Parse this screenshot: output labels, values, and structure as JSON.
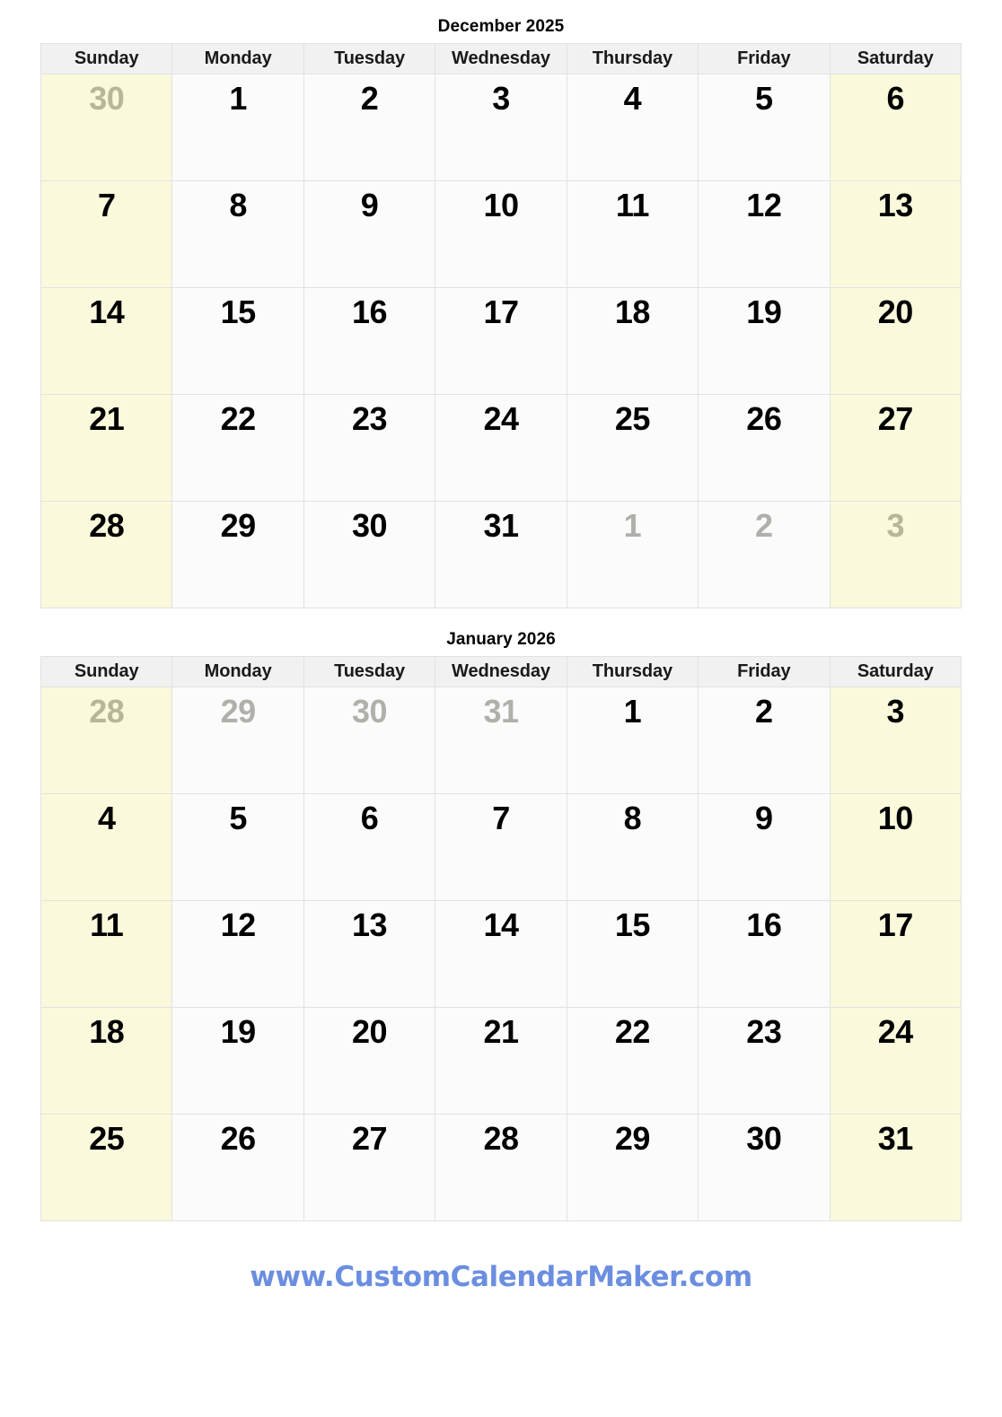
{
  "colors": {
    "weekend_background": "#faf9dc",
    "weekday_background": "#fbfbfb",
    "header_background": "#f1f1f1",
    "out_of_month_text": "#b0b0ab",
    "in_month_text": "#000000",
    "footer_link": "#6b8ee0",
    "grid_border": "#e2e2e2"
  },
  "weekday_headers": [
    "Sunday",
    "Monday",
    "Tuesday",
    "Wednesday",
    "Thursday",
    "Friday",
    "Saturday"
  ],
  "months": [
    {
      "title": "December 2025",
      "weeks": [
        [
          {
            "day": "30",
            "in_month": false
          },
          {
            "day": "1",
            "in_month": true
          },
          {
            "day": "2",
            "in_month": true
          },
          {
            "day": "3",
            "in_month": true
          },
          {
            "day": "4",
            "in_month": true
          },
          {
            "day": "5",
            "in_month": true
          },
          {
            "day": "6",
            "in_month": true
          }
        ],
        [
          {
            "day": "7",
            "in_month": true
          },
          {
            "day": "8",
            "in_month": true
          },
          {
            "day": "9",
            "in_month": true
          },
          {
            "day": "10",
            "in_month": true
          },
          {
            "day": "11",
            "in_month": true
          },
          {
            "day": "12",
            "in_month": true
          },
          {
            "day": "13",
            "in_month": true
          }
        ],
        [
          {
            "day": "14",
            "in_month": true
          },
          {
            "day": "15",
            "in_month": true
          },
          {
            "day": "16",
            "in_month": true
          },
          {
            "day": "17",
            "in_month": true
          },
          {
            "day": "18",
            "in_month": true
          },
          {
            "day": "19",
            "in_month": true
          },
          {
            "day": "20",
            "in_month": true
          }
        ],
        [
          {
            "day": "21",
            "in_month": true
          },
          {
            "day": "22",
            "in_month": true
          },
          {
            "day": "23",
            "in_month": true
          },
          {
            "day": "24",
            "in_month": true
          },
          {
            "day": "25",
            "in_month": true
          },
          {
            "day": "26",
            "in_month": true
          },
          {
            "day": "27",
            "in_month": true
          }
        ],
        [
          {
            "day": "28",
            "in_month": true
          },
          {
            "day": "29",
            "in_month": true
          },
          {
            "day": "30",
            "in_month": true
          },
          {
            "day": "31",
            "in_month": true
          },
          {
            "day": "1",
            "in_month": false
          },
          {
            "day": "2",
            "in_month": false
          },
          {
            "day": "3",
            "in_month": false
          }
        ]
      ]
    },
    {
      "title": "January 2026",
      "weeks": [
        [
          {
            "day": "28",
            "in_month": false
          },
          {
            "day": "29",
            "in_month": false
          },
          {
            "day": "30",
            "in_month": false
          },
          {
            "day": "31",
            "in_month": false
          },
          {
            "day": "1",
            "in_month": true
          },
          {
            "day": "2",
            "in_month": true
          },
          {
            "day": "3",
            "in_month": true
          }
        ],
        [
          {
            "day": "4",
            "in_month": true
          },
          {
            "day": "5",
            "in_month": true
          },
          {
            "day": "6",
            "in_month": true
          },
          {
            "day": "7",
            "in_month": true
          },
          {
            "day": "8",
            "in_month": true
          },
          {
            "day": "9",
            "in_month": true
          },
          {
            "day": "10",
            "in_month": true
          }
        ],
        [
          {
            "day": "11",
            "in_month": true
          },
          {
            "day": "12",
            "in_month": true
          },
          {
            "day": "13",
            "in_month": true
          },
          {
            "day": "14",
            "in_month": true
          },
          {
            "day": "15",
            "in_month": true
          },
          {
            "day": "16",
            "in_month": true
          },
          {
            "day": "17",
            "in_month": true
          }
        ],
        [
          {
            "day": "18",
            "in_month": true
          },
          {
            "day": "19",
            "in_month": true
          },
          {
            "day": "20",
            "in_month": true
          },
          {
            "day": "21",
            "in_month": true
          },
          {
            "day": "22",
            "in_month": true
          },
          {
            "day": "23",
            "in_month": true
          },
          {
            "day": "24",
            "in_month": true
          }
        ],
        [
          {
            "day": "25",
            "in_month": true
          },
          {
            "day": "26",
            "in_month": true
          },
          {
            "day": "27",
            "in_month": true
          },
          {
            "day": "28",
            "in_month": true
          },
          {
            "day": "29",
            "in_month": true
          },
          {
            "day": "30",
            "in_month": true
          },
          {
            "day": "31",
            "in_month": true
          }
        ]
      ]
    }
  ],
  "footer": {
    "url_label": "www.CustomCalendarMaker.com"
  }
}
